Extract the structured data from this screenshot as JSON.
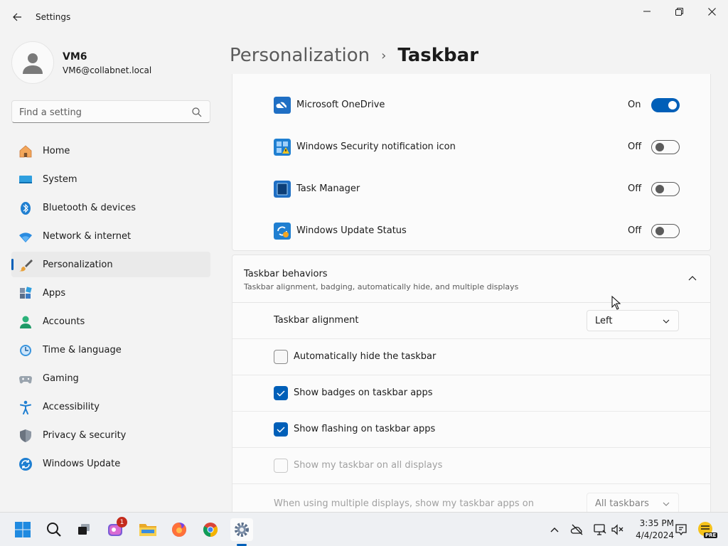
{
  "window": {
    "title": "Settings"
  },
  "profile": {
    "name": "VM6",
    "email": "VM6@collabnet.local"
  },
  "search": {
    "placeholder": "Find a setting"
  },
  "nav": [
    {
      "label": "Home",
      "icon": "home-icon"
    },
    {
      "label": "System",
      "icon": "system-icon"
    },
    {
      "label": "Bluetooth & devices",
      "icon": "bluetooth-icon"
    },
    {
      "label": "Network & internet",
      "icon": "wifi-icon"
    },
    {
      "label": "Personalization",
      "icon": "brush-icon",
      "selected": true
    },
    {
      "label": "Apps",
      "icon": "apps-icon"
    },
    {
      "label": "Accounts",
      "icon": "accounts-icon"
    },
    {
      "label": "Time & language",
      "icon": "clock-icon"
    },
    {
      "label": "Gaming",
      "icon": "gamepad-icon"
    },
    {
      "label": "Accessibility",
      "icon": "accessibility-icon"
    },
    {
      "label": "Privacy & security",
      "icon": "shield-icon"
    },
    {
      "label": "Windows Update",
      "icon": "update-icon"
    }
  ],
  "breadcrumb": {
    "parent": "Personalization",
    "separator": "›",
    "current": "Taskbar"
  },
  "tray_items": [
    {
      "label": "Microsoft OneDrive",
      "state": "On",
      "on": true,
      "icon": "onedrive-icon"
    },
    {
      "label": "Windows Security notification icon",
      "state": "Off",
      "on": false,
      "icon": "windows-security-icon"
    },
    {
      "label": "Task Manager",
      "state": "Off",
      "on": false,
      "icon": "task-manager-icon"
    },
    {
      "label": "Windows Update Status",
      "state": "Off",
      "on": false,
      "icon": "windows-update-status-icon"
    }
  ],
  "behaviors": {
    "title": "Taskbar behaviors",
    "subtitle": "Taskbar alignment, badging, automatically hide, and multiple displays",
    "alignment": {
      "label": "Taskbar alignment",
      "value": "Left"
    },
    "auto_hide": {
      "label": "Automatically hide the taskbar",
      "checked": false
    },
    "badges": {
      "label": "Show badges on taskbar apps",
      "checked": true
    },
    "flashing": {
      "label": "Show flashing on taskbar apps",
      "checked": true
    },
    "all_displays": {
      "label": "Show my taskbar on all displays",
      "checked": false,
      "disabled": true
    },
    "multi_display": {
      "label": "When using multiple displays, show my taskbar apps on",
      "value": "All taskbars",
      "disabled": true
    }
  },
  "taskbar": {
    "notification_badge": "1",
    "time": "3:35 PM",
    "date": "4/4/2024",
    "pre_badge": "PRE"
  },
  "colors": {
    "accent": "#005fb8",
    "background": "#f3f3f3",
    "card": "#fbfbfb"
  }
}
